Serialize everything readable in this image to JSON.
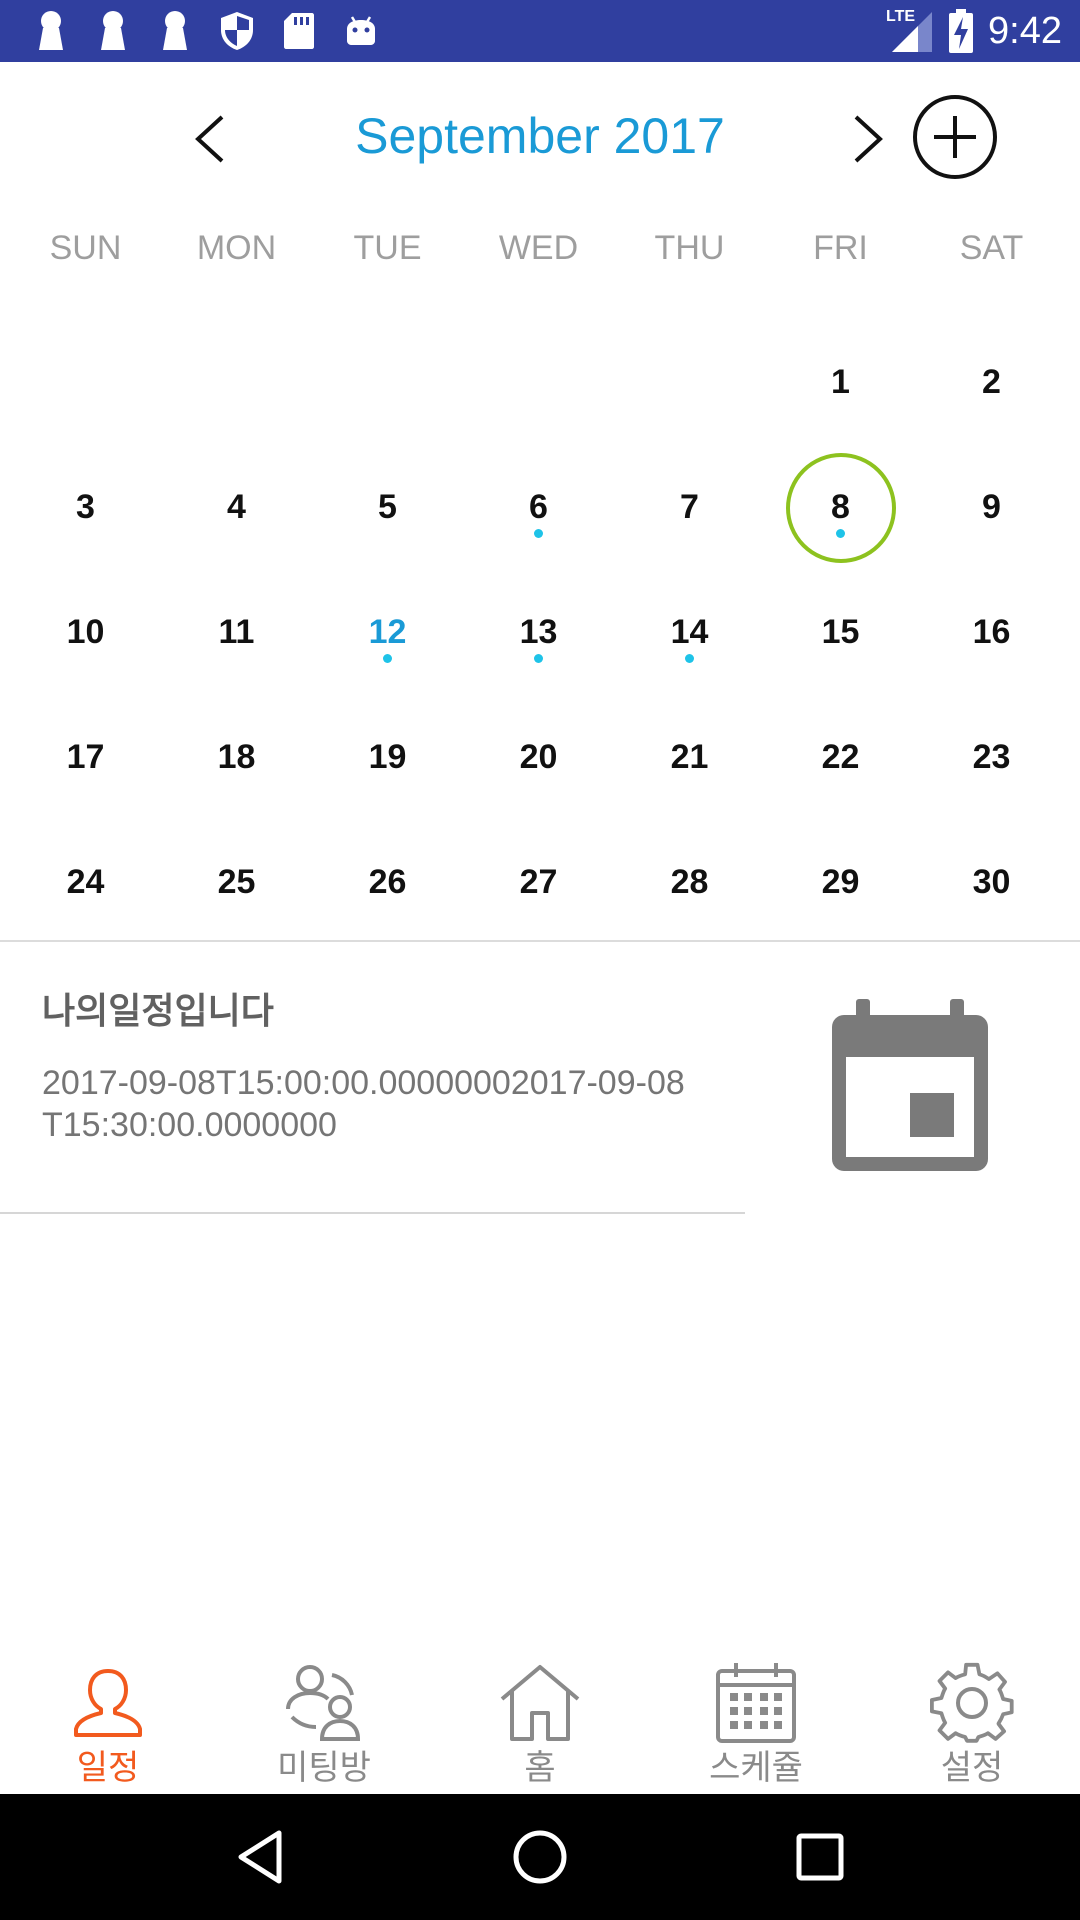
{
  "status_bar": {
    "time": "9:42",
    "network": "LTE",
    "left_icons": [
      "keyhole-icon",
      "keyhole-icon",
      "keyhole-icon",
      "shield-icon",
      "sd-card-icon",
      "android-icon"
    ],
    "right_icons": [
      "signal-icon",
      "battery-charging-icon"
    ]
  },
  "calendar": {
    "month_title": "September 2017",
    "prev_icon": "chevron-left-icon",
    "next_icon": "chevron-right-icon",
    "add_icon": "add-circle-icon",
    "weekdays": [
      "SUN",
      "MON",
      "TUE",
      "WED",
      "THU",
      "FRI",
      "SAT"
    ],
    "days": [
      "",
      "",
      "",
      "",
      "",
      "1",
      "2",
      "3",
      "4",
      "5",
      "6",
      "7",
      "8",
      "9",
      "10",
      "11",
      "12",
      "13",
      "14",
      "15",
      "16",
      "17",
      "18",
      "19",
      "20",
      "21",
      "22",
      "23",
      "24",
      "25",
      "26",
      "27",
      "28",
      "29",
      "30"
    ],
    "today": "12",
    "selected": "8",
    "days_with_events": [
      "6",
      "8",
      "12",
      "13",
      "14"
    ],
    "colors": {
      "title": "#1a9ad6",
      "today": "#1a9ad6",
      "selected_ring": "#8dc21f",
      "event_dot": "#1ec3e8"
    }
  },
  "event": {
    "title": "나의일정입니다",
    "time_line1": "2017-09-08T15:00:00.00000002017-09-08",
    "time_line2": "T15:30:00.0000000",
    "icon": "calendar-icon"
  },
  "tabs": [
    {
      "label": "일정",
      "icon": "person-icon",
      "active": true
    },
    {
      "label": "미팅방",
      "icon": "meeting-people-icon",
      "active": false
    },
    {
      "label": "홈",
      "icon": "home-icon",
      "active": false
    },
    {
      "label": "스케쥴",
      "icon": "schedule-grid-icon",
      "active": false
    },
    {
      "label": "설정",
      "icon": "gear-icon",
      "active": false
    }
  ],
  "tab_colors": {
    "active": "#f25a1e",
    "inactive": "#8a8a8a"
  },
  "nav_bar": {
    "icons": [
      "back-triangle-icon",
      "home-circle-icon",
      "recents-square-icon"
    ]
  }
}
